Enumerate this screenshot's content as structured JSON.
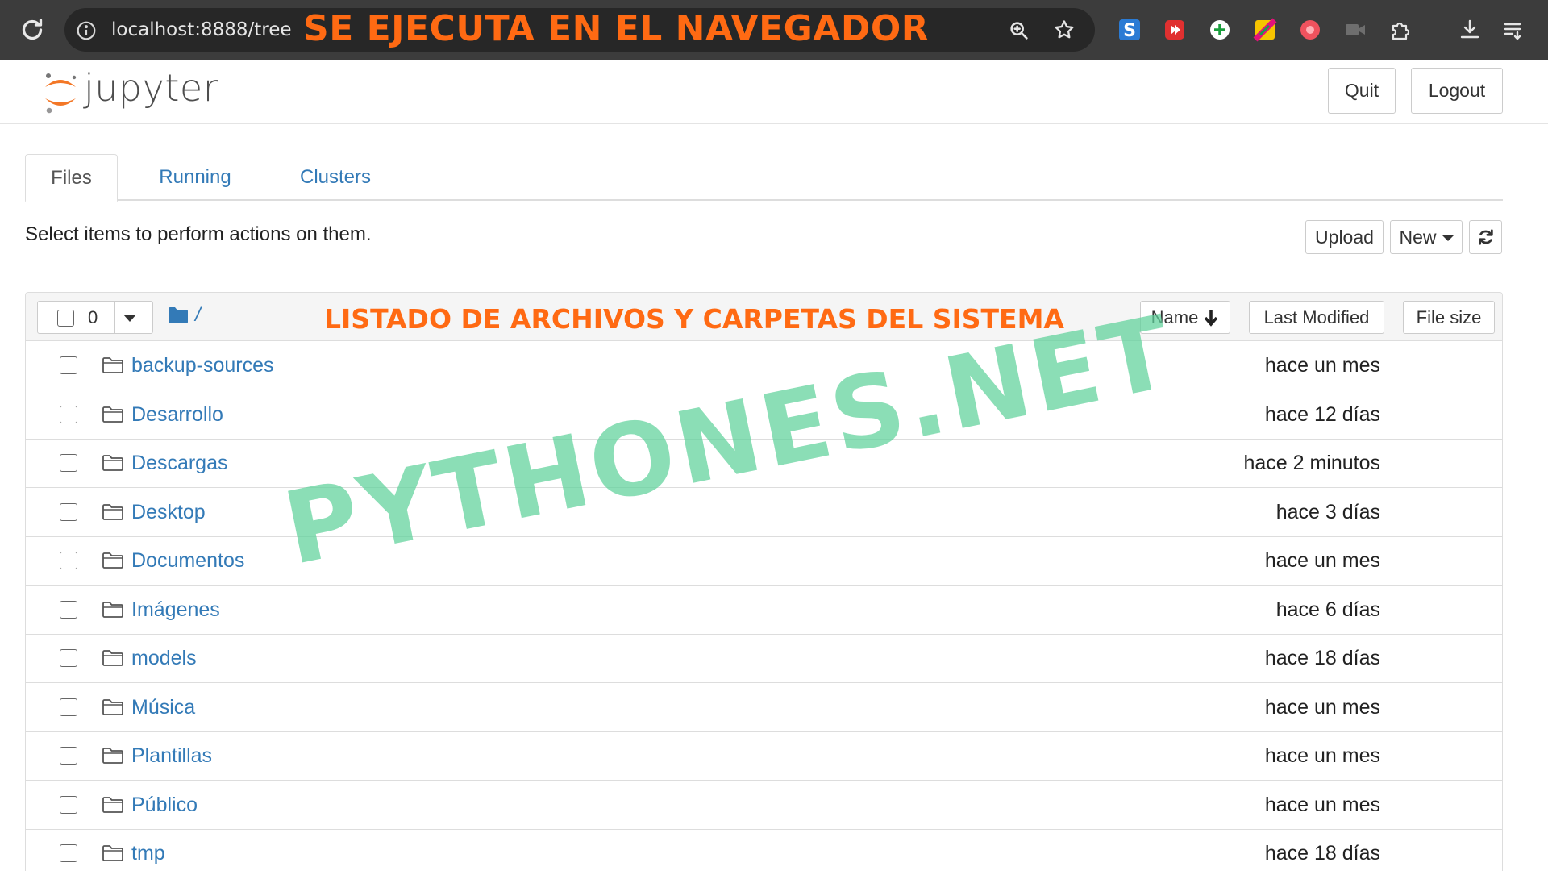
{
  "browser": {
    "url": "localhost:8888/tree",
    "banner": "SE EJECUTA EN EL NAVEGADOR"
  },
  "header": {
    "logo_text": "jupyter",
    "quit_label": "Quit",
    "logout_label": "Logout"
  },
  "tabs": [
    {
      "label": "Files",
      "active": true
    },
    {
      "label": "Running",
      "active": false
    },
    {
      "label": "Clusters",
      "active": false
    }
  ],
  "toolbar": {
    "hint": "Select items to perform actions on them.",
    "upload_label": "Upload",
    "new_label": "New"
  },
  "list": {
    "selected_count": "0",
    "breadcrumb_root": "/",
    "banner": "LISTADO DE ARCHIVOS Y CARPETAS DEL SISTEMA",
    "columns": {
      "name": "Name",
      "modified": "Last Modified",
      "size": "File size"
    },
    "rows": [
      {
        "name": "backup-sources",
        "modified": "hace un mes"
      },
      {
        "name": "Desarrollo",
        "modified": "hace 12 días"
      },
      {
        "name": "Descargas",
        "modified": "hace 2 minutos"
      },
      {
        "name": "Desktop",
        "modified": "hace 3 días"
      },
      {
        "name": "Documentos",
        "modified": "hace un mes"
      },
      {
        "name": "Imágenes",
        "modified": "hace 6 días"
      },
      {
        "name": "models",
        "modified": "hace 18 días"
      },
      {
        "name": "Música",
        "modified": "hace un mes"
      },
      {
        "name": "Plantillas",
        "modified": "hace un mes"
      },
      {
        "name": "Público",
        "modified": "hace un mes"
      },
      {
        "name": "tmp",
        "modified": "hace 18 días"
      }
    ]
  },
  "watermark": "PYTHONES.NET",
  "colors": {
    "link": "#337ab7",
    "banner": "#ff6a13",
    "watermark": "#5fd29b",
    "jupyter_orange": "#f37726"
  }
}
